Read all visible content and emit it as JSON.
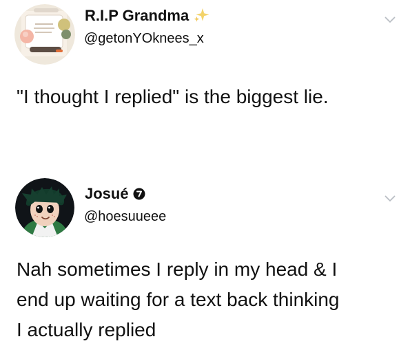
{
  "tweets": [
    {
      "display_name": "R.I.P Grandma",
      "handle": "@getonYOknees_x",
      "text": "\"I thought I replied\" is the biggest lie.",
      "name_icon": "sparkle-icon",
      "menu_icon": "chevron-down-icon"
    },
    {
      "display_name": "Josué",
      "handle": "@hoesuueee",
      "text_lines": [
        "Nah sometimes I reply in my head & I",
        "end up waiting for a text back thinking",
        "I actually replied"
      ],
      "name_icon": "verified-icon",
      "menu_icon": "chevron-down-icon"
    }
  ],
  "colors": {
    "text": "#111111",
    "handle": "#111111",
    "chevron": "#b9bec4",
    "sparkle": "#f2c94c",
    "verified": "#111111"
  }
}
